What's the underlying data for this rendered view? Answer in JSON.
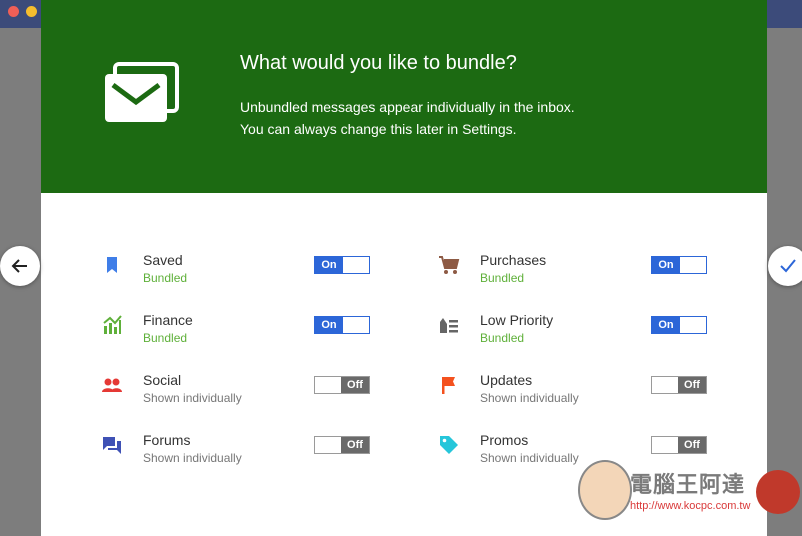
{
  "window": {
    "controls": [
      "close",
      "minimize",
      "zoom"
    ]
  },
  "hero": {
    "icon": "bundle-mail-icon",
    "title": "What would you like to bundle?",
    "desc_line1": "Unbundled messages appear individually in the inbox.",
    "desc_line2": "You can always change this later in Settings."
  },
  "nav": {
    "back_icon": "arrow-left-icon",
    "done_icon": "checkmark-icon"
  },
  "bundles": {
    "saved": {
      "name": "Saved",
      "status": "Bundled",
      "toggle": "On",
      "icon": "bookmark-icon"
    },
    "purchases": {
      "name": "Purchases",
      "status": "Bundled",
      "toggle": "On",
      "icon": "cart-icon"
    },
    "finance": {
      "name": "Finance",
      "status": "Bundled",
      "toggle": "On",
      "icon": "chart-icon"
    },
    "lowpriority": {
      "name": "Low Priority",
      "status": "Bundled",
      "toggle": "On",
      "icon": "low-priority-icon"
    },
    "social": {
      "name": "Social",
      "status": "Shown individually",
      "toggle": "Off",
      "icon": "people-icon"
    },
    "updates": {
      "name": "Updates",
      "status": "Shown individually",
      "toggle": "Off",
      "icon": "flag-icon"
    },
    "forums": {
      "name": "Forums",
      "status": "Shown individually",
      "toggle": "Off",
      "icon": "forum-icon"
    },
    "promos": {
      "name": "Promos",
      "status": "Shown individually",
      "toggle": "Off",
      "icon": "tag-icon"
    }
  },
  "watermark": {
    "text": "電腦王阿達",
    "url": "http://www.kocpc.com.tw"
  },
  "colors": {
    "hero_bg": "#1c6a12",
    "toggle_on": "#2c66d8",
    "toggle_off": "#6a6a6a",
    "bundled_text": "#5fb03a"
  }
}
